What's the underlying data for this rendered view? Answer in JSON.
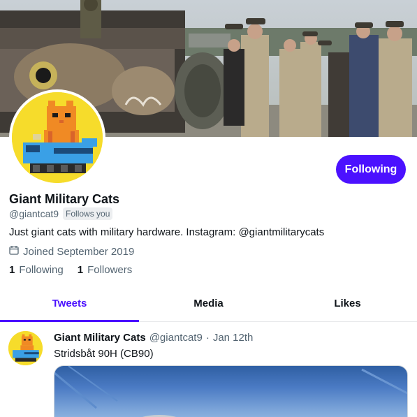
{
  "profile": {
    "name": "Giant Military Cats",
    "handle": "@giantcat9",
    "follows_you_label": "Follows you",
    "bio": "Just giant cats with military hardware. Instagram: @giantmilitarycats",
    "joined": "Joined September 2019",
    "follow_button_label": "Following",
    "following_count": "1",
    "following_label": "Following",
    "followers_count": "1",
    "followers_label": "Followers"
  },
  "tabs": [
    {
      "label": "Tweets",
      "active": true
    },
    {
      "label": "Media",
      "active": false
    },
    {
      "label": "Likes",
      "active": false
    }
  ],
  "tweet": {
    "name": "Giant Military Cats",
    "handle": "@giantcat9",
    "separator": "·",
    "date": "Jan 12th",
    "text": "Stridsbåt 90H (CB90)"
  },
  "colors": {
    "accent": "#4b11ff",
    "secondary_text": "#536471",
    "avatar_bg": "#f6dc2b"
  },
  "icons": {
    "joined": "calendar-icon"
  }
}
